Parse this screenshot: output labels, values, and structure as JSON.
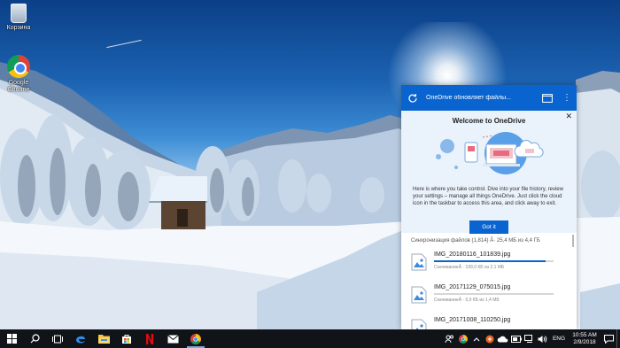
{
  "desktop": {
    "icons": [
      {
        "label": "Корзина",
        "icon": "recycle-bin-icon"
      },
      {
        "label": "Google Chrome",
        "icon": "chrome-icon"
      }
    ]
  },
  "onedrive": {
    "header_title": "OneDrive обновляет файлы...",
    "welcome": {
      "title": "Welcome to OneDrive",
      "text": "Here is where you take control. Dive into your file history, review your settings – manage all things OneDrive. Just click the cloud icon in the taskbar to access this area, and click away to exit.",
      "button": "Got it"
    },
    "status": "Синхронизация файлов (1,814) Â· 25,4 МБ из 4,4 ГБ",
    "files": [
      {
        "name": "IMG_20180116_101839.jpg",
        "detail": "СкачиваниеÂ · 199,0 КБ из 2,1 МБ",
        "progress": 0.93
      },
      {
        "name": "IMG_20171129_075015.jpg",
        "detail": "СкачиваниеÂ · 0,0 КБ из 1,4 МБ",
        "progress": 0.0
      },
      {
        "name": "IMG_20171008_110250.jpg",
        "detail": "",
        "progress": 0.0
      }
    ],
    "colors": {
      "accent": "#0a64cf",
      "panel": "#eaf2fb"
    }
  },
  "taskbar": {
    "apps": [
      "start-icon",
      "search-icon",
      "task-view-icon",
      "edge-icon",
      "file-explorer-icon",
      "store-icon",
      "netflix-icon",
      "mail-icon",
      "chrome-icon"
    ],
    "language": "ENG",
    "time": "10:55 AM",
    "date": "2/9/2018"
  }
}
